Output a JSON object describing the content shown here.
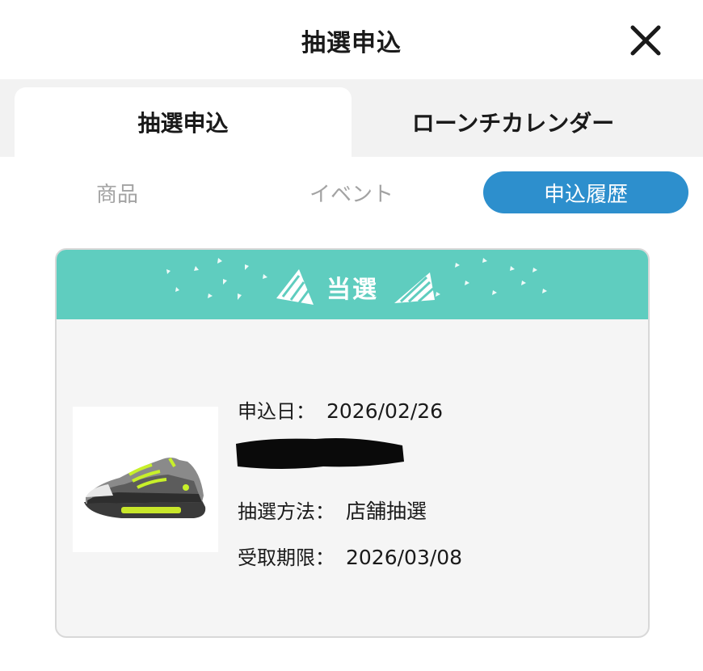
{
  "header": {
    "title": "抽選申込"
  },
  "tabs": [
    {
      "label": "抽選申込",
      "active": true
    },
    {
      "label": "ローンチカレンダー",
      "active": false
    }
  ],
  "subtabs": [
    {
      "label": "商品",
      "active": false
    },
    {
      "label": "イベント",
      "active": false
    },
    {
      "label": "申込履歴",
      "active": true
    }
  ],
  "card": {
    "status": "当選",
    "fields": [
      {
        "label": "申込日：",
        "value": "2026/02/26"
      },
      {
        "label": "抽選方法：",
        "value": "店舗抽選"
      },
      {
        "label": "受取期限：",
        "value": "2026/03/08"
      }
    ],
    "image": "sneaker-product-image"
  },
  "colors": {
    "accent_blue": "#2d8fcd",
    "banner_teal": "#5fcdbf",
    "inactive_text": "#a3a3a3"
  },
  "icons": {
    "close": "close-icon"
  }
}
